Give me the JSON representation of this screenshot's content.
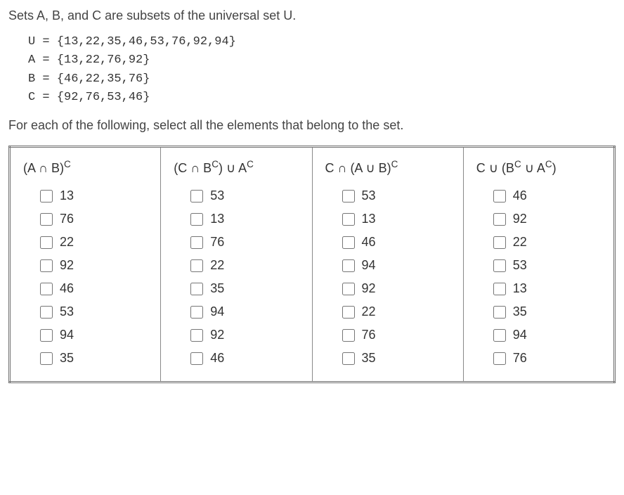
{
  "intro": "Sets A, B, and C are subsets of the universal set U.",
  "definitions": {
    "U": "U = {13,22,35,46,53,76,92,94}",
    "A": "A = {13,22,76,92}",
    "B": "B = {46,22,35,76}",
    "C": "C = {92,76,53,46}"
  },
  "instruction": "For each of the following, select all the elements that belong to the set.",
  "columns": [
    {
      "header_plain": "(A ∩ B)^C",
      "options": [
        "13",
        "76",
        "22",
        "92",
        "46",
        "53",
        "94",
        "35"
      ]
    },
    {
      "header_plain": "(C ∩ B^C) ∪ A^C",
      "options": [
        "53",
        "13",
        "76",
        "22",
        "35",
        "94",
        "92",
        "46"
      ]
    },
    {
      "header_plain": "C ∩ (A ∪ B)^C",
      "options": [
        "53",
        "13",
        "46",
        "94",
        "92",
        "22",
        "76",
        "35"
      ]
    },
    {
      "header_plain": "C ∪ (B^C ∪ A^C)",
      "options": [
        "46",
        "92",
        "22",
        "53",
        "13",
        "35",
        "94",
        "76"
      ]
    }
  ]
}
